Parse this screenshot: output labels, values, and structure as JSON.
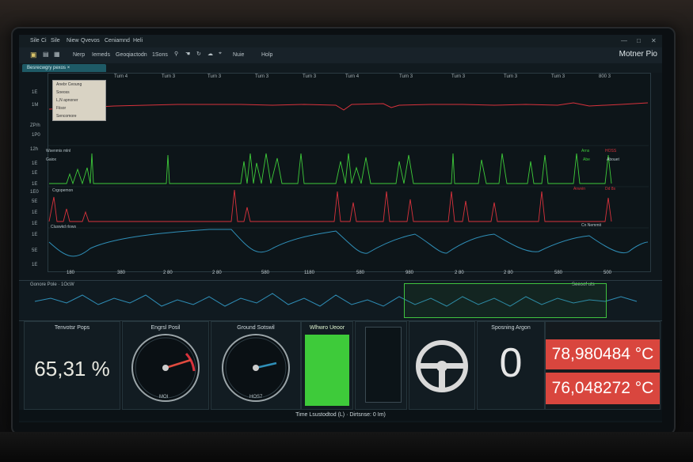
{
  "menu": [
    "Sile",
    "Ci",
    "Sile",
    "Niew",
    "Qvevos",
    "Ceniamnd",
    "Heli"
  ],
  "toolbar": [
    "Nerp",
    "Iemeds",
    "Geoqiactodn",
    "1Sons",
    "Nuie",
    "Holp"
  ],
  "app_title": "Motner Pio",
  "tab_label": "Besrecwgry pexos",
  "legend": [
    "Anebr Ceoung",
    "Soeoss",
    "L,N apnoner",
    "Fiisor",
    "Sencomore"
  ],
  "y_labels": [
    "1E",
    "1M",
    "1E",
    "1A",
    "1E",
    "ZP/h",
    "1P0",
    "12h",
    "1E",
    "1E",
    "1E",
    "1E0",
    "5E",
    "1E",
    "1E",
    "1E",
    "5E",
    "1E",
    "1E"
  ],
  "x_top": [
    "Turn 4",
    "Turn 3",
    "Turn 3",
    "Turn 3",
    "Turn 3",
    "Turn 4",
    "Turn 3",
    "Turn 3",
    "Turn 3",
    "Turn 3",
    "TurnT3",
    "Turn 3",
    "800 3"
  ],
  "x_bottom": [
    "180",
    "380",
    "2 80",
    "2 80",
    "580",
    "1180",
    "580",
    "980",
    "2 80",
    "2 80",
    "580",
    "500"
  ],
  "series_tags": {
    "green": "Wsenmis mlnl",
    "green_sub": "Gaiox",
    "red": "Crgopemon",
    "blue": "Cluswkd rlows",
    "right_green_1": "Arns",
    "right_green_2": "Abe",
    "right_red_1": "HOSS",
    "right_red_2": "Abouet",
    "right_red_3": "Arwvin",
    "right_red_4": "Dd 8s",
    "right_blue": "Cn Nemmit"
  },
  "overview": {
    "left_label": "Gonore Pole · 1OcW",
    "right_label": "Seeoof uts"
  },
  "panels": {
    "throttle": {
      "title": "Tenvotsr Pops",
      "value": "65,31 %",
      "fraction": 0.6531
    },
    "engine": {
      "title": "Engrsl Posil",
      "caption": "MOI"
    },
    "ground": {
      "title": "Ground Sotswil",
      "caption": "HOS7"
    },
    "green_bar": {
      "title": "Wlhwro Ueoor",
      "level": 1.0
    },
    "steering": {
      "title": "Sposning Argon",
      "value": "0"
    },
    "temp": {
      "t1": "78,980484 °C",
      "t2": "76,048272 °C"
    }
  },
  "status": "Time  Lsustodtod (L) · Dirtsnse: 0 Im)",
  "colors": {
    "red": "#d8323c",
    "green": "#3ecb3a",
    "blue": "#2f8fb8",
    "temp_bg": "#d9463e"
  }
}
